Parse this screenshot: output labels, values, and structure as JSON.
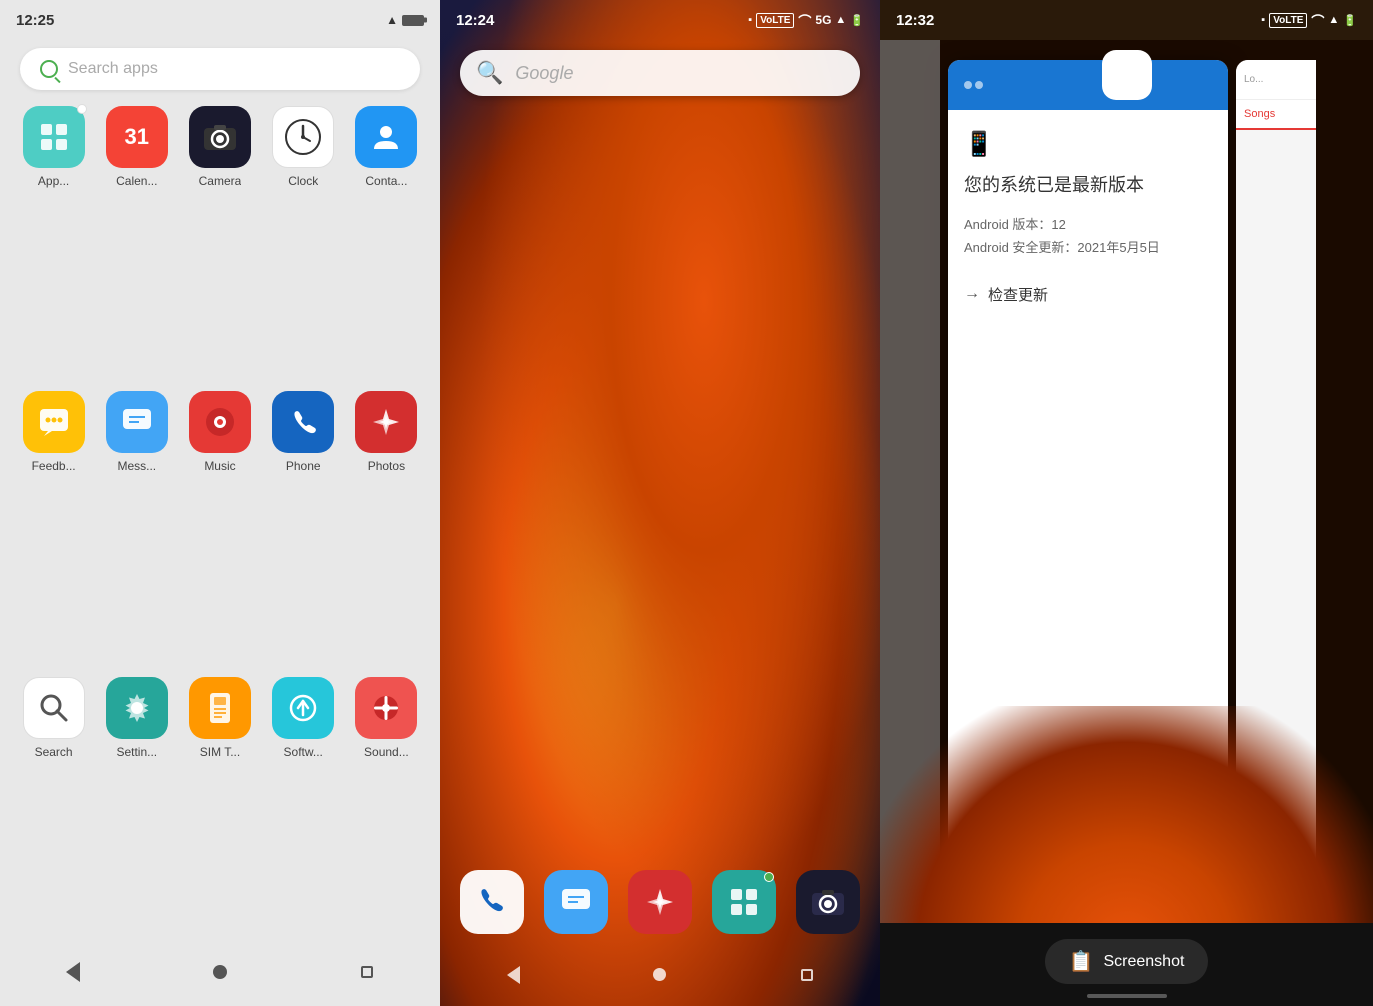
{
  "phone1": {
    "time": "12:25",
    "search_placeholder": "Search apps",
    "apps": [
      {
        "name": "App...",
        "label": "App...",
        "color": "green-teal",
        "symbol": "⊞"
      },
      {
        "name": "Calendar",
        "label": "Calen...",
        "color": "red",
        "symbol": "31"
      },
      {
        "name": "Camera",
        "label": "Camera",
        "color": "dark",
        "symbol": "◉"
      },
      {
        "name": "Clock",
        "label": "Clock",
        "color": "white-border",
        "symbol": "🕐"
      },
      {
        "name": "Contacts",
        "label": "Conta...",
        "color": "blue",
        "symbol": "👤"
      },
      {
        "name": "Feedback",
        "label": "Feedb...",
        "color": "yellow",
        "symbol": "💬"
      },
      {
        "name": "Messages",
        "label": "Mess...",
        "color": "blue-msg",
        "symbol": "💬"
      },
      {
        "name": "Music",
        "label": "Music",
        "color": "red-music",
        "symbol": "♪"
      },
      {
        "name": "Phone",
        "label": "Phone",
        "color": "phone-blue",
        "symbol": "📞"
      },
      {
        "name": "Photos",
        "label": "Photos",
        "color": "red-photos",
        "symbol": "🌸"
      },
      {
        "name": "Search",
        "label": "Search",
        "color": "white-search",
        "symbol": "🔍"
      },
      {
        "name": "Settings",
        "label": "Settin...",
        "color": "teal-settings",
        "symbol": "⚙"
      },
      {
        "name": "SIM Toolkit",
        "label": "SIM T...",
        "color": "orange-sim",
        "symbol": "📱"
      },
      {
        "name": "Software Update",
        "label": "Softw...",
        "color": "teal-sw",
        "symbol": "↑"
      },
      {
        "name": "Sound Recorder",
        "label": "Sound...",
        "color": "red-sound",
        "symbol": "🎙"
      }
    ],
    "nav": {
      "back": "◀",
      "home": "●",
      "recents": "■"
    }
  },
  "phone2": {
    "time": "12:24",
    "signal": "5G",
    "google_placeholder": "Google",
    "dock_apps": [
      {
        "name": "Phone",
        "color": "white-bg",
        "symbol": "📞"
      },
      {
        "name": "Messages",
        "color": "blue-msg-dock",
        "symbol": "💬"
      },
      {
        "name": "Photos",
        "color": "red-photos-dock",
        "symbol": "🌸"
      },
      {
        "name": "AppVault",
        "color": "teal-dock",
        "symbol": "⊞",
        "has_dot": true
      },
      {
        "name": "Camera",
        "color": "dark-cam",
        "symbol": "◉"
      }
    ]
  },
  "phone3": {
    "time": "12:32",
    "card": {
      "title": "您的系统已是最新版本",
      "android_version_label": "Android 版本：",
      "android_version": "12",
      "security_update_label": "Android 安全更新：",
      "security_update": "2021年5月5日",
      "check_update": "检查更新"
    },
    "right_card": {
      "search_placeholder": "Lo...",
      "tab": "Songs"
    },
    "screenshot_label": "Screenshot"
  }
}
